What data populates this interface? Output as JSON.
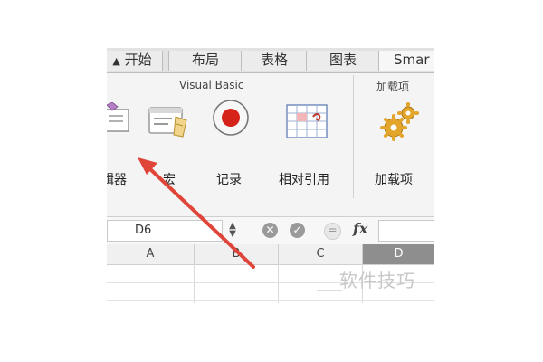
{
  "ribbon_tabs": [
    "开始",
    "布局",
    "表格",
    "图表",
    "Smar"
  ],
  "groups": {
    "visual_basic": "Visual Basic",
    "addins": "加载项"
  },
  "buttons": {
    "editor_partial": "辑器",
    "macro": "宏",
    "record": "记录",
    "relative_ref": "相对引用",
    "addins": "加载项"
  },
  "formula_bar": {
    "name_box": "D6",
    "fx": "fx"
  },
  "columns": [
    "A",
    "B",
    "C",
    "D"
  ],
  "watermark": "软件技巧",
  "colors": {
    "arrow": "#e0453a",
    "record": "#d6231a",
    "selected_header": "#8e8e8e"
  }
}
